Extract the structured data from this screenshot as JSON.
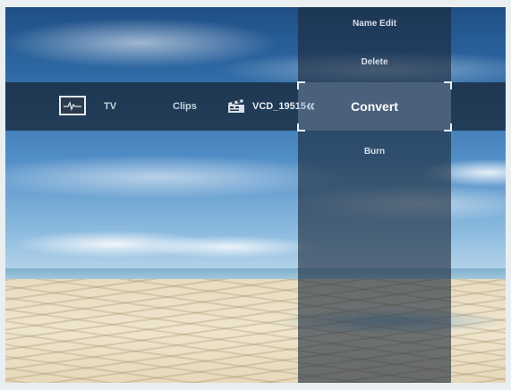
{
  "nav": {
    "tv_label": "TV",
    "clips_label": "Clips",
    "vcd_label": "VCD_19515",
    "chevron": "«"
  },
  "menu": {
    "items": [
      {
        "label": "Name Edit"
      },
      {
        "label": "Delete"
      },
      {
        "label": "Convert",
        "selected": true
      },
      {
        "label": "Burn"
      }
    ]
  },
  "icons": {
    "monitor": "monitor-icon",
    "clapperboard": "clapperboard-icon",
    "chevron": "chevron-left-double-icon"
  },
  "colors": {
    "bar": "#16222f",
    "text": "#c9d3de",
    "highlight": "#8caacd"
  }
}
